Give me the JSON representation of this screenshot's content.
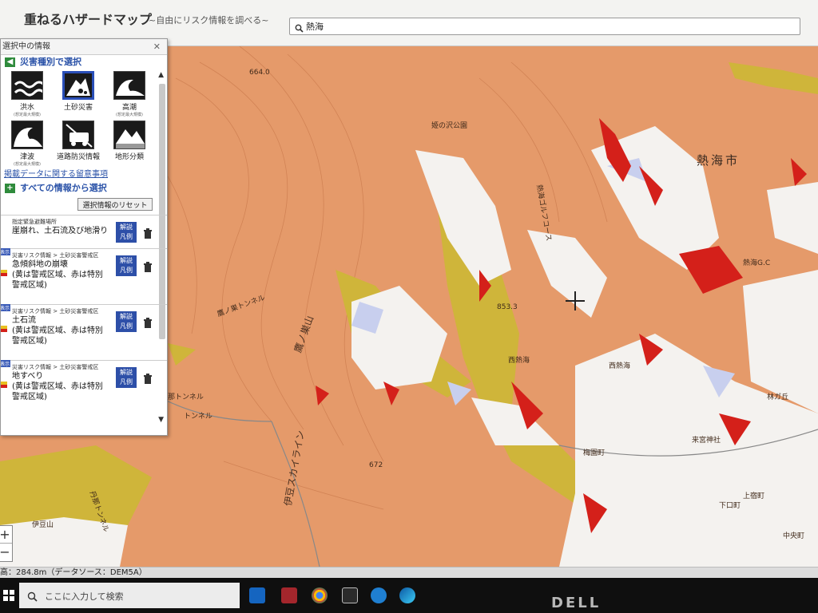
{
  "header": {
    "title": "重ねるハザードマップ",
    "subtitle": "~自由にリスク情報を調べる~",
    "search_value": "熱海"
  },
  "panel": {
    "heading": "選択中の情報",
    "by_hazard_link": "災害種別で選択",
    "hazards": [
      {
        "label": "洪水",
        "sub": "(想定最大規模)",
        "icon": "flood-icon",
        "selected": false
      },
      {
        "label": "土砂災害",
        "sub": "",
        "icon": "landslide-icon",
        "selected": true
      },
      {
        "label": "高潮",
        "sub": "(想定最大規模)",
        "icon": "storm-surge-icon",
        "selected": false
      },
      {
        "label": "津波",
        "sub": "(想定最大規模)",
        "icon": "tsunami-icon",
        "selected": false
      },
      {
        "label": "道路防災情報",
        "sub": "",
        "icon": "road-info-icon",
        "selected": false
      },
      {
        "label": "地形分類",
        "sub": "",
        "icon": "terrain-icon",
        "selected": false
      }
    ],
    "notes_link": "掲載データに関する留意事項",
    "all_info_link": "すべての情報から選択",
    "reset_label": "選択情報のリセット",
    "layers": [
      {
        "category": "指定緊急避難場所",
        "name": "崖崩れ、土石流及び地滑り",
        "desc1": "",
        "desc2": "",
        "tag": "",
        "swatch": ""
      },
      {
        "category": "災害リスク情報 > 土砂災害警戒区",
        "name": "急傾斜地の崩壊",
        "desc1": "(黄は警戒区域、赤は特別",
        "desc2": "警戒区域)",
        "tag": "表示",
        "swatch": "#e8c020"
      },
      {
        "category": "災害リスク情報 > 土砂災害警戒区",
        "name": "土石流",
        "desc1": "(黄は警戒区域、赤は特別",
        "desc2": "警戒区域)",
        "tag": "表示",
        "swatch": "#e8c020"
      },
      {
        "category": "災害リスク情報 > 土砂災害警戒区",
        "name": "地すべり",
        "desc1": "(黄は警戒区域、赤は特別",
        "desc2": "警戒区域)",
        "tag": "表示",
        "swatch": "#e8c020"
      }
    ],
    "info_button_line1": "解説",
    "info_button_line2": "凡例"
  },
  "map": {
    "labels": {
      "atami_city": "熱海市",
      "mount": "鷹ノ巣山",
      "nishi_atami": "西熱海",
      "nishi_atami_st": "西熱海",
      "skyline": "伊豆スカイライン",
      "atami_gc": "熱海G.C",
      "umezono": "梅園町",
      "tunnel1": "トンネル",
      "tunnel2": "那トンネル",
      "tunnel_mid": "鷹ノ巣トンネル",
      "himenosawa": "姫の沢公園",
      "kamisaka": "上宿町",
      "nakanocho": "中央町",
      "kaguchi": "下口町",
      "tanna": "丹那トンネル",
      "hayashigaoka": "林ガ丘",
      "izusan": "伊豆山",
      "elev_text_1": "853.3",
      "elev_text_2": "664.0",
      "elev_text_3": "672",
      "temple": "来宮神社",
      "atami_golf": "熱海ゴルフコース"
    },
    "elevation_readout": "高：284.8m（データソース：DEM5A）"
  },
  "taskbar": {
    "search_placeholder": "ここに入力して検索"
  },
  "monitor_brand": "DELL",
  "colors": {
    "landslide_area": "#e59a6a",
    "warning_zone": "#cfb53a",
    "special_warning_zone": "#d4201a",
    "accent_blue": "#2d4fa8"
  }
}
